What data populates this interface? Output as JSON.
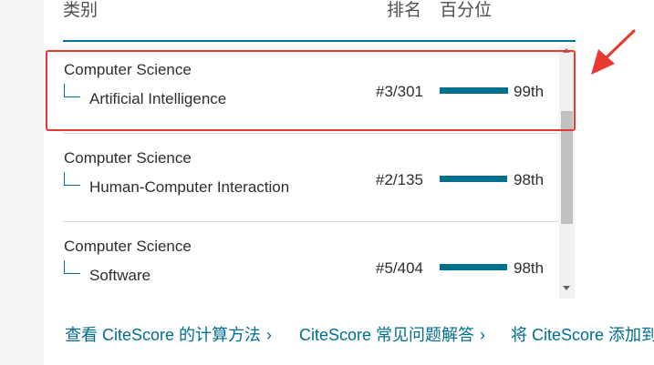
{
  "header": {
    "category_label": "类别",
    "rank_label": "排名",
    "percentile_label": "百分位"
  },
  "rows": [
    {
      "parent": "Computer Science",
      "child": "Artificial Intelligence",
      "rank": "#3/301",
      "percentile_label": "99th",
      "percentile": 0.99,
      "highlighted": true
    },
    {
      "parent": "Computer Science",
      "child": "Human-Computer Interaction",
      "rank": "#2/135",
      "percentile_label": "98th",
      "percentile": 0.98,
      "highlighted": false
    },
    {
      "parent": "Computer Science",
      "child": "Software",
      "rank": "#5/404",
      "percentile_label": "98th",
      "percentile": 0.98,
      "highlighted": false
    }
  ],
  "footer": {
    "links": [
      {
        "label": "查看 CiteScore 的计算方法",
        "icon": "chevron-right-icon"
      },
      {
        "label": "CiteScore 常见问题解答",
        "icon": "chevron-right-icon"
      },
      {
        "label": "将 CiteScore 添加到",
        "icon": ""
      }
    ]
  },
  "colors": {
    "accent": "#007398",
    "bar": "#00708f",
    "highlight": "#e8392e",
    "link": "#006e8f"
  }
}
